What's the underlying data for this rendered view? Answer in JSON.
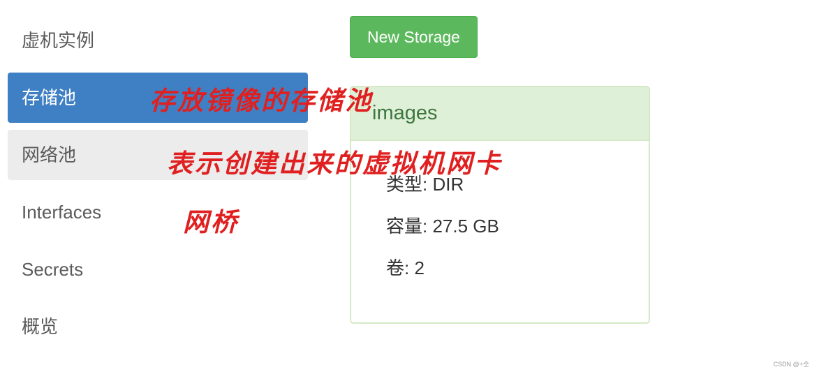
{
  "sidebar": {
    "items": [
      {
        "label": "虚机实例",
        "state": "default"
      },
      {
        "label": "存储池",
        "state": "active"
      },
      {
        "label": "网络池",
        "state": "hover"
      },
      {
        "label": "Interfaces",
        "state": "default"
      },
      {
        "label": "Secrets",
        "state": "default"
      },
      {
        "label": "概览",
        "state": "default"
      }
    ]
  },
  "toolbar": {
    "new_storage_label": "New Storage"
  },
  "storage_panel": {
    "title": "images",
    "rows": [
      {
        "text": "类型: DIR"
      },
      {
        "text": "容量: 27.5 GB"
      },
      {
        "text": "卷: 2"
      }
    ]
  },
  "annotations": [
    {
      "text": "存放镜像的存储池"
    },
    {
      "text": "表示创建出来的虚拟机网卡"
    },
    {
      "text": "网桥"
    }
  ],
  "watermark": "CSDN @+仝",
  "colors": {
    "active_nav": "#3f80c4",
    "hover_nav": "#ececec",
    "button_success": "#5cb85c",
    "panel_heading_bg": "#dff0d8",
    "panel_heading_text": "#3c763d",
    "annotation": "#e02020"
  }
}
